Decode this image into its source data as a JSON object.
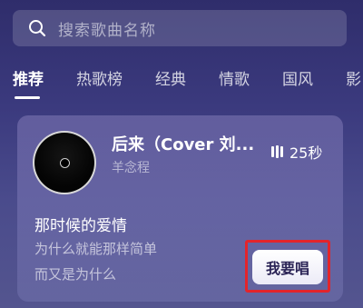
{
  "search": {
    "placeholder": "搜索歌曲名称",
    "icon": "search-icon"
  },
  "tabs": [
    {
      "label": "推荐",
      "active": true
    },
    {
      "label": "热歌榜",
      "active": false
    },
    {
      "label": "经典",
      "active": false
    },
    {
      "label": "情歌",
      "active": false
    },
    {
      "label": "国风",
      "active": false
    },
    {
      "label": "影",
      "active": false
    }
  ],
  "song_card": {
    "title": "后来（Cover 刘...",
    "artist": "羊念程",
    "duration": "25秒",
    "lyrics": [
      "那时候的爱情",
      "为什么就能那样简单",
      "而又是为什么"
    ],
    "sing_button_label": "我要唱",
    "highlight_color": "#e3242b"
  }
}
